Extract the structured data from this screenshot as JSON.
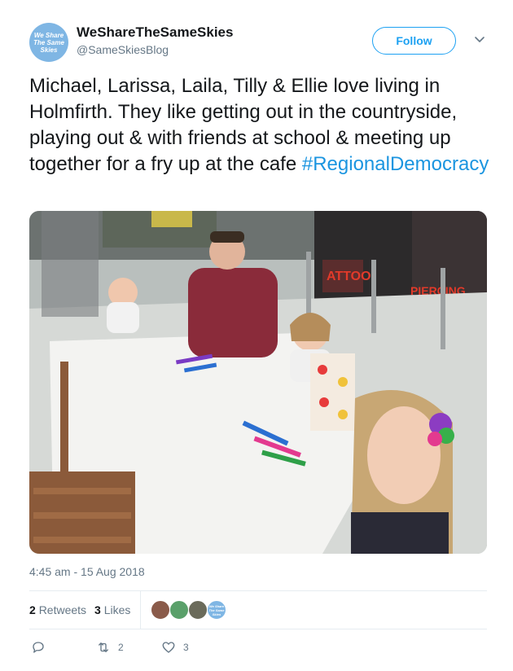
{
  "user": {
    "display_name": "WeShareTheSameSkies",
    "handle": "@SameSkiesBlog",
    "avatar_lines": [
      "We Share",
      "The Same",
      "Skies"
    ],
    "follow_label": "Follow"
  },
  "tweet": {
    "text": "Michael, Larissa, Laila, Tilly & Ellie love living in Holmfirth. They like getting out in the countryside, playing out & with friends at school & meeting up together for a fry up at the cafe ",
    "hashtag": "#RegionalDemocracy",
    "timestamp": "4:45 am - 15 Aug 2018",
    "photo_sign_text_1": "ATTOO",
    "photo_sign_text_2": "PIERCING"
  },
  "stats": {
    "retweets_count": "2",
    "retweets_label": "Retweets",
    "likes_count": "3",
    "likes_label": "Likes",
    "liker_avatar_text": "We Share The Same Skies"
  },
  "actions": {
    "reply_count": "",
    "retweet_count": "2",
    "like_count": "3"
  },
  "colors": {
    "accent": "#1da1f2",
    "hashtag": "#1b95e0",
    "muted": "#657786"
  },
  "icons": [
    "chevron-down-icon",
    "reply-icon",
    "retweet-icon",
    "heart-icon"
  ]
}
